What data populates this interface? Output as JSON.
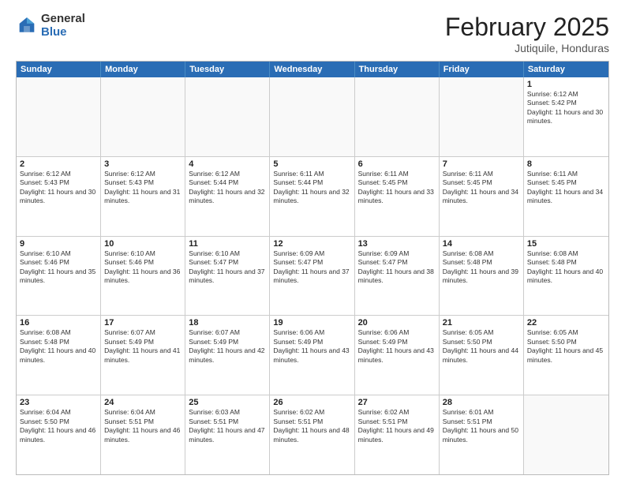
{
  "logo": {
    "general": "General",
    "blue": "Blue"
  },
  "header": {
    "month": "February 2025",
    "location": "Jutiquile, Honduras"
  },
  "weekdays": [
    "Sunday",
    "Monday",
    "Tuesday",
    "Wednesday",
    "Thursday",
    "Friday",
    "Saturday"
  ],
  "weeks": [
    [
      {
        "day": "",
        "info": ""
      },
      {
        "day": "",
        "info": ""
      },
      {
        "day": "",
        "info": ""
      },
      {
        "day": "",
        "info": ""
      },
      {
        "day": "",
        "info": ""
      },
      {
        "day": "",
        "info": ""
      },
      {
        "day": "1",
        "info": "Sunrise: 6:12 AM\nSunset: 5:42 PM\nDaylight: 11 hours and 30 minutes."
      }
    ],
    [
      {
        "day": "2",
        "info": "Sunrise: 6:12 AM\nSunset: 5:43 PM\nDaylight: 11 hours and 30 minutes."
      },
      {
        "day": "3",
        "info": "Sunrise: 6:12 AM\nSunset: 5:43 PM\nDaylight: 11 hours and 31 minutes."
      },
      {
        "day": "4",
        "info": "Sunrise: 6:12 AM\nSunset: 5:44 PM\nDaylight: 11 hours and 32 minutes."
      },
      {
        "day": "5",
        "info": "Sunrise: 6:11 AM\nSunset: 5:44 PM\nDaylight: 11 hours and 32 minutes."
      },
      {
        "day": "6",
        "info": "Sunrise: 6:11 AM\nSunset: 5:45 PM\nDaylight: 11 hours and 33 minutes."
      },
      {
        "day": "7",
        "info": "Sunrise: 6:11 AM\nSunset: 5:45 PM\nDaylight: 11 hours and 34 minutes."
      },
      {
        "day": "8",
        "info": "Sunrise: 6:11 AM\nSunset: 5:45 PM\nDaylight: 11 hours and 34 minutes."
      }
    ],
    [
      {
        "day": "9",
        "info": "Sunrise: 6:10 AM\nSunset: 5:46 PM\nDaylight: 11 hours and 35 minutes."
      },
      {
        "day": "10",
        "info": "Sunrise: 6:10 AM\nSunset: 5:46 PM\nDaylight: 11 hours and 36 minutes."
      },
      {
        "day": "11",
        "info": "Sunrise: 6:10 AM\nSunset: 5:47 PM\nDaylight: 11 hours and 37 minutes."
      },
      {
        "day": "12",
        "info": "Sunrise: 6:09 AM\nSunset: 5:47 PM\nDaylight: 11 hours and 37 minutes."
      },
      {
        "day": "13",
        "info": "Sunrise: 6:09 AM\nSunset: 5:47 PM\nDaylight: 11 hours and 38 minutes."
      },
      {
        "day": "14",
        "info": "Sunrise: 6:08 AM\nSunset: 5:48 PM\nDaylight: 11 hours and 39 minutes."
      },
      {
        "day": "15",
        "info": "Sunrise: 6:08 AM\nSunset: 5:48 PM\nDaylight: 11 hours and 40 minutes."
      }
    ],
    [
      {
        "day": "16",
        "info": "Sunrise: 6:08 AM\nSunset: 5:48 PM\nDaylight: 11 hours and 40 minutes."
      },
      {
        "day": "17",
        "info": "Sunrise: 6:07 AM\nSunset: 5:49 PM\nDaylight: 11 hours and 41 minutes."
      },
      {
        "day": "18",
        "info": "Sunrise: 6:07 AM\nSunset: 5:49 PM\nDaylight: 11 hours and 42 minutes."
      },
      {
        "day": "19",
        "info": "Sunrise: 6:06 AM\nSunset: 5:49 PM\nDaylight: 11 hours and 43 minutes."
      },
      {
        "day": "20",
        "info": "Sunrise: 6:06 AM\nSunset: 5:49 PM\nDaylight: 11 hours and 43 minutes."
      },
      {
        "day": "21",
        "info": "Sunrise: 6:05 AM\nSunset: 5:50 PM\nDaylight: 11 hours and 44 minutes."
      },
      {
        "day": "22",
        "info": "Sunrise: 6:05 AM\nSunset: 5:50 PM\nDaylight: 11 hours and 45 minutes."
      }
    ],
    [
      {
        "day": "23",
        "info": "Sunrise: 6:04 AM\nSunset: 5:50 PM\nDaylight: 11 hours and 46 minutes."
      },
      {
        "day": "24",
        "info": "Sunrise: 6:04 AM\nSunset: 5:51 PM\nDaylight: 11 hours and 46 minutes."
      },
      {
        "day": "25",
        "info": "Sunrise: 6:03 AM\nSunset: 5:51 PM\nDaylight: 11 hours and 47 minutes."
      },
      {
        "day": "26",
        "info": "Sunrise: 6:02 AM\nSunset: 5:51 PM\nDaylight: 11 hours and 48 minutes."
      },
      {
        "day": "27",
        "info": "Sunrise: 6:02 AM\nSunset: 5:51 PM\nDaylight: 11 hours and 49 minutes."
      },
      {
        "day": "28",
        "info": "Sunrise: 6:01 AM\nSunset: 5:51 PM\nDaylight: 11 hours and 50 minutes."
      },
      {
        "day": "",
        "info": ""
      }
    ]
  ]
}
